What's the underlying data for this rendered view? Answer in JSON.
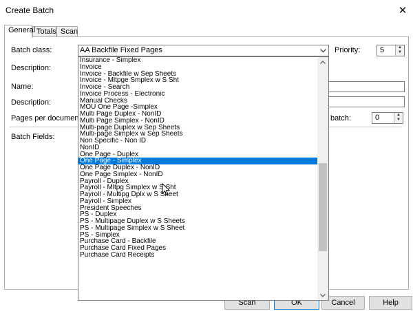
{
  "window": {
    "title": "Create Batch",
    "close_glyph": "✕"
  },
  "tabs": [
    {
      "label": "General",
      "active": true
    },
    {
      "label": "Totals",
      "active": false
    },
    {
      "label": "Scan",
      "active": false
    }
  ],
  "form": {
    "batch_class_label": "Batch class:",
    "batch_class_value": "AA Backfile Fixed Pages",
    "priority_label": "Priority:",
    "priority_value": "5",
    "description1_label": "Description:",
    "name_label": "Name:",
    "description2_label": "Description:",
    "pages_per_document_label": "Pages per document:",
    "batch_label": "batch:",
    "batch_value": "0",
    "batch_fields_label": "Batch Fields:"
  },
  "dropdown": {
    "items": [
      "Insurance - Simplex",
      "Invoice",
      "Invoice - Backfile w Sep Sheets",
      "Invoice - Mltpge Smplex w S Sht",
      "Invoice - Search",
      "Invoice Process - Electronic",
      "Manual Checks",
      "MOU One Page -Simplex",
      "Multi Page Duplex - NonID",
      "Multi Page Simplex - NonID",
      "Multi-page Duplex w Sep Sheets",
      "Multi-page Simplex w Sep Sheets",
      "Non Specific - Non ID",
      "NonID",
      "One Page - Duplex",
      "One Page - Simplex",
      "One Page Duplex - NonID",
      "One Page Simplex - NonID",
      "Payroll - Duplex",
      "Payroll - Mltpg Simplex w S Sht",
      "Payroll - Multipg Dplx w S Sheet",
      "Payroll - Simplex",
      "President Speeches",
      "PS - Duplex",
      "PS - Multipage Duplex w S Sheets",
      "PS - Multipage Simplex w S Sheet",
      "PS - Simplex",
      "Purchase Card - Backfile",
      "Purchase Card Fixed Pages",
      "Purchase Card Receipts"
    ],
    "selected": "One Page - Simplex"
  },
  "buttons": {
    "scan": "Scan",
    "ok": "OK",
    "cancel": "Cancel",
    "help": "Help"
  },
  "colors": {
    "selection": "#0078d7",
    "accent_border": "#0078d7"
  }
}
